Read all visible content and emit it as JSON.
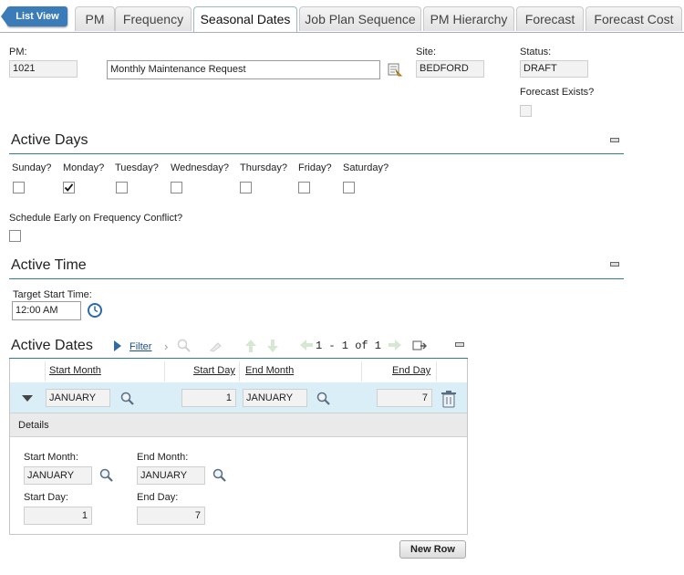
{
  "tabs": {
    "list_view": "List View",
    "items": [
      "PM",
      "Frequency",
      "Seasonal Dates",
      "Job Plan Sequence",
      "PM Hierarchy",
      "Forecast",
      "Forecast Cost"
    ]
  },
  "header": {
    "pm_label": "PM:",
    "pm_value": "1021",
    "description": "Monthly Maintenance Request",
    "site_label": "Site:",
    "site_value": "BEDFORD",
    "status_label": "Status:",
    "status_value": "DRAFT",
    "forecast_label": "Forecast Exists?"
  },
  "active_days": {
    "title": "Active Days",
    "days": [
      "Sunday?",
      "Monday?",
      "Tuesday?",
      "Wednesday?",
      "Thursday?",
      "Friday?",
      "Saturday?"
    ],
    "checked": [
      false,
      true,
      false,
      false,
      false,
      false,
      false
    ],
    "schedule_early_label": "Schedule Early on Frequency Conflict?"
  },
  "active_time": {
    "title": "Active Time",
    "target_start_label": "Target Start Time:",
    "target_start_value": "12:00 AM"
  },
  "active_dates": {
    "title": "Active Dates",
    "filter_label": "Filter",
    "pagination": "1 - 1 of 1",
    "columns": [
      "Start Month",
      "Start Day",
      "End Month",
      "End Day"
    ],
    "row": {
      "start_month": "JANUARY",
      "start_day": "1",
      "end_month": "JANUARY",
      "end_day": "7"
    },
    "details": {
      "title": "Details",
      "start_month_label": "Start Month:",
      "end_month_label": "End Month:",
      "start_day_label": "Start Day:",
      "end_day_label": "End Day:",
      "start_month": "JANUARY",
      "end_month": "JANUARY",
      "start_day": "1",
      "end_day": "7"
    },
    "new_row_label": "New Row"
  }
}
